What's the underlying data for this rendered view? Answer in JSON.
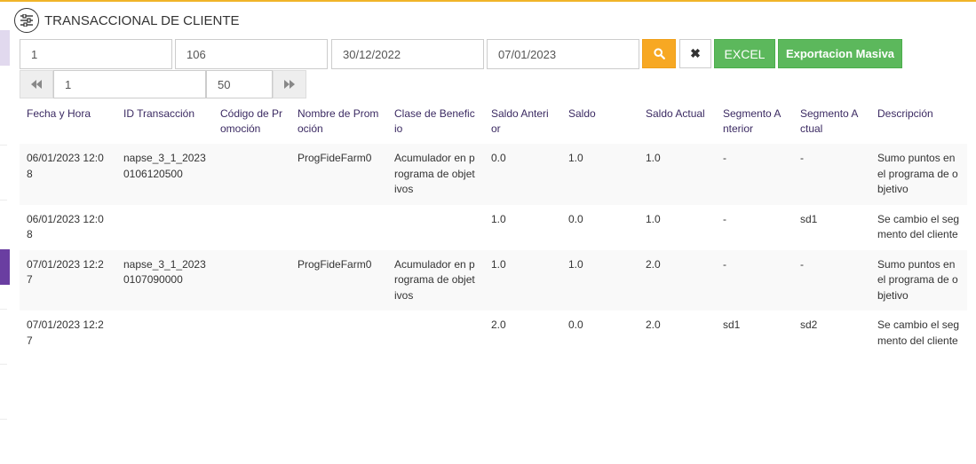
{
  "header": {
    "title": "TRANSACCIONAL DE CLIENTE"
  },
  "filters": {
    "field1": "1",
    "field2": "106",
    "date_from": "30/12/2022",
    "date_to": "07/01/2023"
  },
  "buttons": {
    "search_icon": "search-icon",
    "clear_icon": "close-icon",
    "clear_glyph": "✖",
    "excel_label": "EXCEL",
    "export_label": "Exportacion Masiva"
  },
  "pagination": {
    "page": "1",
    "page_size": "50",
    "prev_icon": "fast-backward-icon",
    "next_icon": "fast-forward-icon"
  },
  "colors": {
    "accent": "#f7a823",
    "success": "#5cb85c",
    "header_text": "#3b2a62"
  },
  "table": {
    "columns": [
      "Fecha y Hora",
      "ID Transacción",
      "Código de Promoción",
      "Nombre de Promoción",
      "Clase de Beneficio",
      "Saldo Anterior",
      "Saldo",
      "Saldo Actual",
      "Segmento Anterior",
      "Segmento Actual",
      "Descripción"
    ],
    "rows": [
      [
        "06/01/2023 12:08",
        "napse_3_1_20230106120500",
        "",
        "ProgFideFarm0",
        "Acumulador en programa de objetivos",
        "0.0",
        "1.0",
        "1.0",
        "-",
        "-",
        "Sumo puntos en el programa de objetivo"
      ],
      [
        "06/01/2023 12:08",
        "",
        "",
        "",
        "",
        "1.0",
        "0.0",
        "1.0",
        "-",
        "sd1",
        "Se cambio el segmento del cliente"
      ],
      [
        "07/01/2023 12:27",
        "napse_3_1_20230107090000",
        "",
        "ProgFideFarm0",
        "Acumulador en programa de objetivos",
        "1.0",
        "1.0",
        "2.0",
        "-",
        "-",
        "Sumo puntos en el programa de objetivo"
      ],
      [
        "07/01/2023 12:27",
        "",
        "",
        "",
        "",
        "2.0",
        "0.0",
        "2.0",
        "sd1",
        "sd2",
        "Se cambio el segmento del cliente"
      ]
    ]
  }
}
